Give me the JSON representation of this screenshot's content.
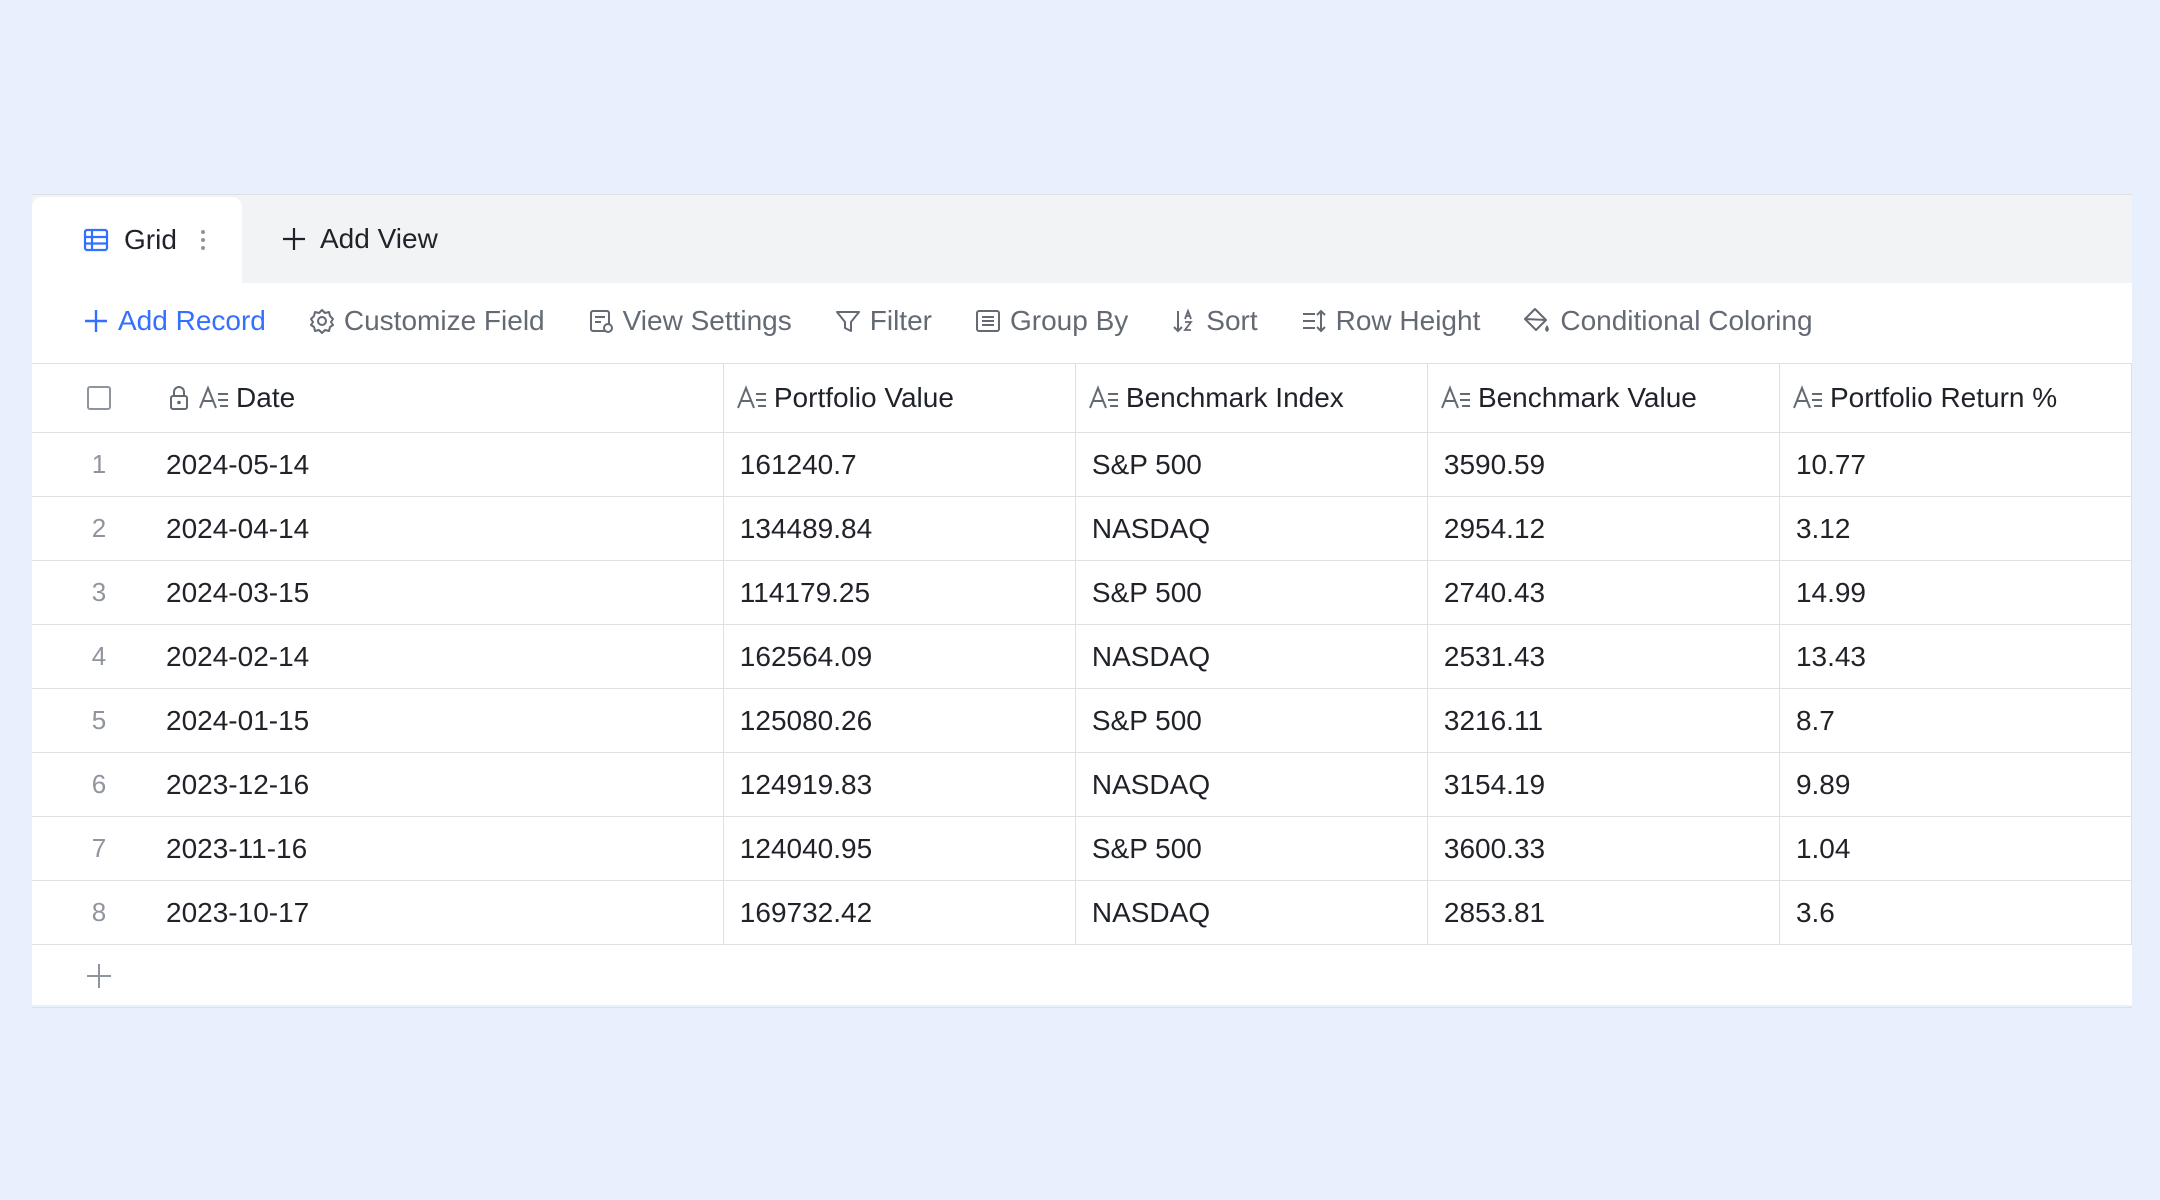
{
  "tabs": {
    "active_label": "Grid",
    "add_view_label": "Add View"
  },
  "toolbar": {
    "add_record": "Add Record",
    "customize_field": "Customize Field",
    "view_settings": "View Settings",
    "filter": "Filter",
    "group_by": "Group By",
    "sort": "Sort",
    "row_height": "Row Height",
    "conditional_coloring": "Conditional Coloring"
  },
  "columns": [
    "Date",
    "Portfolio Value",
    "Benchmark Index",
    "Benchmark Value",
    "Portfolio Return %"
  ],
  "rows": [
    {
      "index": "1",
      "date": "2024-05-14",
      "portfolio_value": "161240.7",
      "benchmark_index": "S&P 500",
      "benchmark_value": "3590.59",
      "portfolio_return": "10.77"
    },
    {
      "index": "2",
      "date": "2024-04-14",
      "portfolio_value": "134489.84",
      "benchmark_index": "NASDAQ",
      "benchmark_value": "2954.12",
      "portfolio_return": "3.12"
    },
    {
      "index": "3",
      "date": "2024-03-15",
      "portfolio_value": "114179.25",
      "benchmark_index": "S&P 500",
      "benchmark_value": "2740.43",
      "portfolio_return": "14.99"
    },
    {
      "index": "4",
      "date": "2024-02-14",
      "portfolio_value": "162564.09",
      "benchmark_index": "NASDAQ",
      "benchmark_value": "2531.43",
      "portfolio_return": "13.43"
    },
    {
      "index": "5",
      "date": "2024-01-15",
      "portfolio_value": "125080.26",
      "benchmark_index": "S&P 500",
      "benchmark_value": "3216.11",
      "portfolio_return": "8.7"
    },
    {
      "index": "6",
      "date": "2023-12-16",
      "portfolio_value": "124919.83",
      "benchmark_index": "NASDAQ",
      "benchmark_value": "3154.19",
      "portfolio_return": "9.89"
    },
    {
      "index": "7",
      "date": "2023-11-16",
      "portfolio_value": "124040.95",
      "benchmark_index": "S&P 500",
      "benchmark_value": "3600.33",
      "portfolio_return": "1.04"
    },
    {
      "index": "8",
      "date": "2023-10-17",
      "portfolio_value": "169732.42",
      "benchmark_index": "NASDAQ",
      "benchmark_value": "2853.81",
      "portfolio_return": "3.6"
    }
  ],
  "colors": {
    "accent": "#3370ff",
    "background": "#e8effd",
    "border": "#dee0e3",
    "muted_text": "#646a73"
  }
}
